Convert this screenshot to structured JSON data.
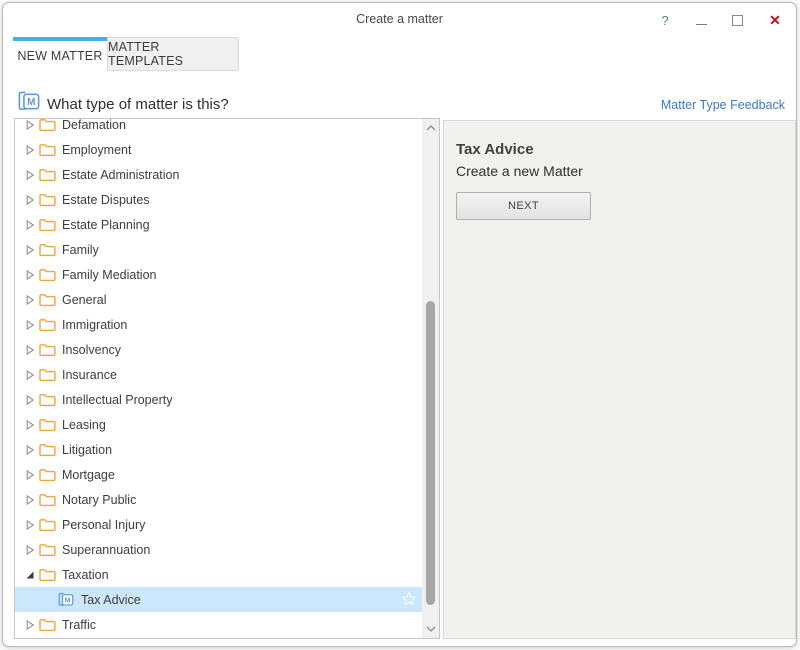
{
  "window": {
    "title": "Create a matter",
    "controls": {
      "help": "?",
      "minimize": "minimize",
      "maximize": "maximize",
      "close": "✕"
    }
  },
  "tabs": [
    {
      "label": "NEW MATTER",
      "active": true
    },
    {
      "label": "MATTER TEMPLATES",
      "active": false
    }
  ],
  "header": {
    "question": "What type of matter is this?",
    "feedback_link": "Matter Type Feedback"
  },
  "tree": {
    "items": [
      {
        "label": "Defamation",
        "icon": "folder",
        "state": "collapsed",
        "level": 0,
        "selected": false
      },
      {
        "label": "Employment",
        "icon": "folder",
        "state": "collapsed",
        "level": 0,
        "selected": false
      },
      {
        "label": "Estate Administration",
        "icon": "folder",
        "state": "collapsed",
        "level": 0,
        "selected": false
      },
      {
        "label": "Estate Disputes",
        "icon": "folder",
        "state": "collapsed",
        "level": 0,
        "selected": false
      },
      {
        "label": "Estate Planning",
        "icon": "folder",
        "state": "collapsed",
        "level": 0,
        "selected": false
      },
      {
        "label": "Family",
        "icon": "folder",
        "state": "collapsed",
        "level": 0,
        "selected": false
      },
      {
        "label": "Family Mediation",
        "icon": "folder",
        "state": "collapsed",
        "level": 0,
        "selected": false
      },
      {
        "label": "General",
        "icon": "folder",
        "state": "collapsed",
        "level": 0,
        "selected": false
      },
      {
        "label": "Immigration",
        "icon": "folder",
        "state": "collapsed",
        "level": 0,
        "selected": false
      },
      {
        "label": "Insolvency",
        "icon": "folder",
        "state": "collapsed",
        "level": 0,
        "selected": false
      },
      {
        "label": "Insurance",
        "icon": "folder",
        "state": "collapsed",
        "level": 0,
        "selected": false
      },
      {
        "label": "Intellectual Property",
        "icon": "folder",
        "state": "collapsed",
        "level": 0,
        "selected": false
      },
      {
        "label": "Leasing",
        "icon": "folder",
        "state": "collapsed",
        "level": 0,
        "selected": false
      },
      {
        "label": "Litigation",
        "icon": "folder",
        "state": "collapsed",
        "level": 0,
        "selected": false
      },
      {
        "label": "Mortgage",
        "icon": "folder",
        "state": "collapsed",
        "level": 0,
        "selected": false
      },
      {
        "label": "Notary Public",
        "icon": "folder",
        "state": "collapsed",
        "level": 0,
        "selected": false
      },
      {
        "label": "Personal Injury",
        "icon": "folder",
        "state": "collapsed",
        "level": 0,
        "selected": false
      },
      {
        "label": "Superannuation",
        "icon": "folder",
        "state": "collapsed",
        "level": 0,
        "selected": false
      },
      {
        "label": "Taxation",
        "icon": "folder",
        "state": "expanded",
        "level": 0,
        "selected": false
      },
      {
        "label": "Tax Advice",
        "icon": "matter",
        "state": "leaf",
        "level": 1,
        "selected": true
      },
      {
        "label": "Traffic",
        "icon": "folder",
        "state": "collapsed",
        "level": 0,
        "selected": false
      }
    ]
  },
  "detail_panel": {
    "title": "Tax Advice",
    "subtitle": "Create a new Matter",
    "next_button": "NEXT"
  },
  "colors": {
    "accent_blue": "#41b1ec",
    "link_blue": "#3b7bc8",
    "folder_orange": "#f0a23c",
    "matter_blue": "#5b9bd8",
    "selection_blue": "#cbe7fb",
    "close_red": "#c1121c"
  }
}
